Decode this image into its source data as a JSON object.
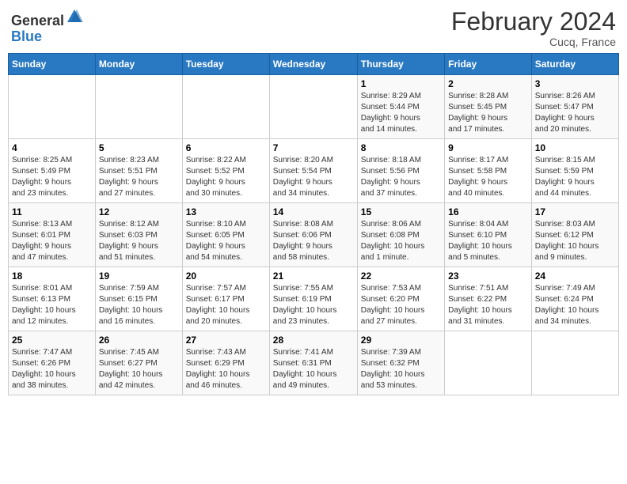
{
  "header": {
    "logo_general": "General",
    "logo_blue": "Blue",
    "month_title": "February 2024",
    "location": "Cucq, France"
  },
  "days_of_week": [
    "Sunday",
    "Monday",
    "Tuesday",
    "Wednesday",
    "Thursday",
    "Friday",
    "Saturday"
  ],
  "weeks": [
    [
      {
        "day": "",
        "info": ""
      },
      {
        "day": "",
        "info": ""
      },
      {
        "day": "",
        "info": ""
      },
      {
        "day": "",
        "info": ""
      },
      {
        "day": "1",
        "info": "Sunrise: 8:29 AM\nSunset: 5:44 PM\nDaylight: 9 hours\nand 14 minutes."
      },
      {
        "day": "2",
        "info": "Sunrise: 8:28 AM\nSunset: 5:45 PM\nDaylight: 9 hours\nand 17 minutes."
      },
      {
        "day": "3",
        "info": "Sunrise: 8:26 AM\nSunset: 5:47 PM\nDaylight: 9 hours\nand 20 minutes."
      }
    ],
    [
      {
        "day": "4",
        "info": "Sunrise: 8:25 AM\nSunset: 5:49 PM\nDaylight: 9 hours\nand 23 minutes."
      },
      {
        "day": "5",
        "info": "Sunrise: 8:23 AM\nSunset: 5:51 PM\nDaylight: 9 hours\nand 27 minutes."
      },
      {
        "day": "6",
        "info": "Sunrise: 8:22 AM\nSunset: 5:52 PM\nDaylight: 9 hours\nand 30 minutes."
      },
      {
        "day": "7",
        "info": "Sunrise: 8:20 AM\nSunset: 5:54 PM\nDaylight: 9 hours\nand 34 minutes."
      },
      {
        "day": "8",
        "info": "Sunrise: 8:18 AM\nSunset: 5:56 PM\nDaylight: 9 hours\nand 37 minutes."
      },
      {
        "day": "9",
        "info": "Sunrise: 8:17 AM\nSunset: 5:58 PM\nDaylight: 9 hours\nand 40 minutes."
      },
      {
        "day": "10",
        "info": "Sunrise: 8:15 AM\nSunset: 5:59 PM\nDaylight: 9 hours\nand 44 minutes."
      }
    ],
    [
      {
        "day": "11",
        "info": "Sunrise: 8:13 AM\nSunset: 6:01 PM\nDaylight: 9 hours\nand 47 minutes."
      },
      {
        "day": "12",
        "info": "Sunrise: 8:12 AM\nSunset: 6:03 PM\nDaylight: 9 hours\nand 51 minutes."
      },
      {
        "day": "13",
        "info": "Sunrise: 8:10 AM\nSunset: 6:05 PM\nDaylight: 9 hours\nand 54 minutes."
      },
      {
        "day": "14",
        "info": "Sunrise: 8:08 AM\nSunset: 6:06 PM\nDaylight: 9 hours\nand 58 minutes."
      },
      {
        "day": "15",
        "info": "Sunrise: 8:06 AM\nSunset: 6:08 PM\nDaylight: 10 hours\nand 1 minute."
      },
      {
        "day": "16",
        "info": "Sunrise: 8:04 AM\nSunset: 6:10 PM\nDaylight: 10 hours\nand 5 minutes."
      },
      {
        "day": "17",
        "info": "Sunrise: 8:03 AM\nSunset: 6:12 PM\nDaylight: 10 hours\nand 9 minutes."
      }
    ],
    [
      {
        "day": "18",
        "info": "Sunrise: 8:01 AM\nSunset: 6:13 PM\nDaylight: 10 hours\nand 12 minutes."
      },
      {
        "day": "19",
        "info": "Sunrise: 7:59 AM\nSunset: 6:15 PM\nDaylight: 10 hours\nand 16 minutes."
      },
      {
        "day": "20",
        "info": "Sunrise: 7:57 AM\nSunset: 6:17 PM\nDaylight: 10 hours\nand 20 minutes."
      },
      {
        "day": "21",
        "info": "Sunrise: 7:55 AM\nSunset: 6:19 PM\nDaylight: 10 hours\nand 23 minutes."
      },
      {
        "day": "22",
        "info": "Sunrise: 7:53 AM\nSunset: 6:20 PM\nDaylight: 10 hours\nand 27 minutes."
      },
      {
        "day": "23",
        "info": "Sunrise: 7:51 AM\nSunset: 6:22 PM\nDaylight: 10 hours\nand 31 minutes."
      },
      {
        "day": "24",
        "info": "Sunrise: 7:49 AM\nSunset: 6:24 PM\nDaylight: 10 hours\nand 34 minutes."
      }
    ],
    [
      {
        "day": "25",
        "info": "Sunrise: 7:47 AM\nSunset: 6:26 PM\nDaylight: 10 hours\nand 38 minutes."
      },
      {
        "day": "26",
        "info": "Sunrise: 7:45 AM\nSunset: 6:27 PM\nDaylight: 10 hours\nand 42 minutes."
      },
      {
        "day": "27",
        "info": "Sunrise: 7:43 AM\nSunset: 6:29 PM\nDaylight: 10 hours\nand 46 minutes."
      },
      {
        "day": "28",
        "info": "Sunrise: 7:41 AM\nSunset: 6:31 PM\nDaylight: 10 hours\nand 49 minutes."
      },
      {
        "day": "29",
        "info": "Sunrise: 7:39 AM\nSunset: 6:32 PM\nDaylight: 10 hours\nand 53 minutes."
      },
      {
        "day": "",
        "info": ""
      },
      {
        "day": "",
        "info": ""
      }
    ]
  ]
}
